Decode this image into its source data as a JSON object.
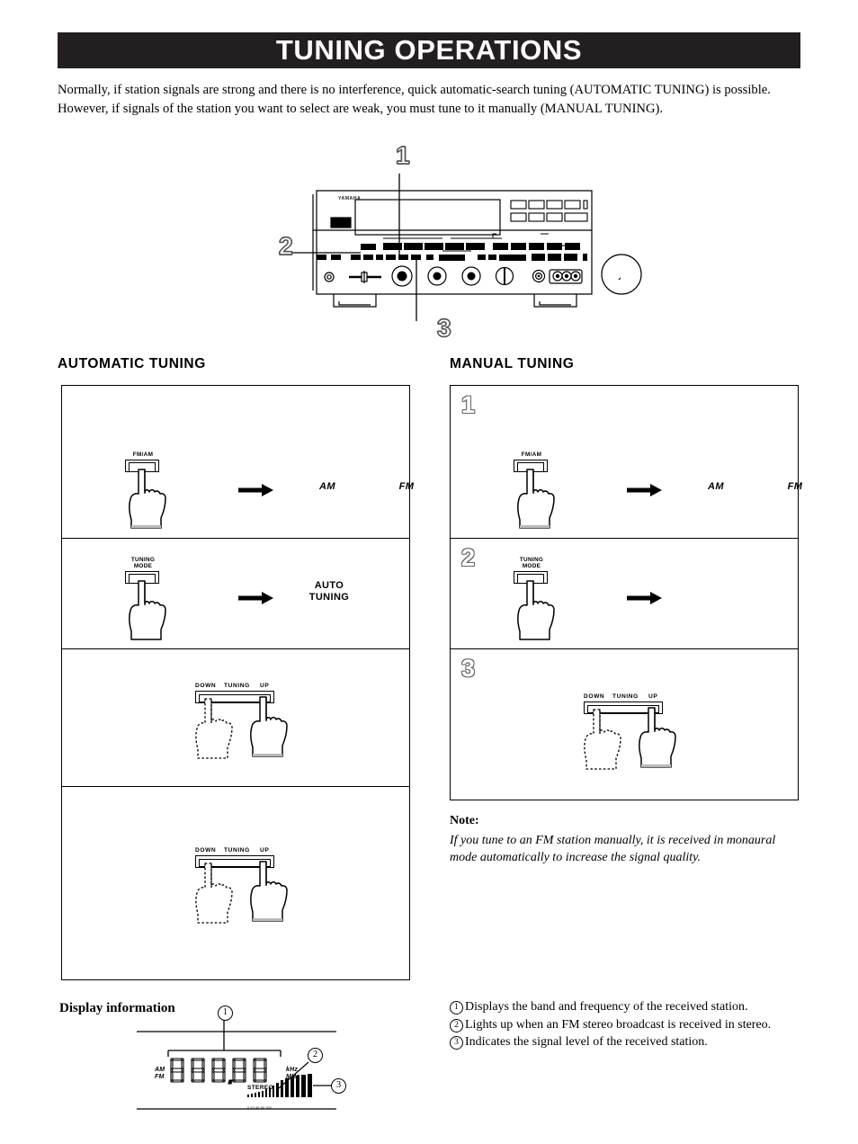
{
  "header": {
    "title": "TUNING OPERATIONS"
  },
  "intro": {
    "text": "Normally, if station signals are strong and there is no interference, quick automatic-search tuning (AUTOMATIC TUNING) is possible. However, if signals of the station you want to select are weak, you must tune to it manually (MANUAL TUNING)."
  },
  "receiver": {
    "brand": "YAMAHA",
    "callouts": [
      {
        "num": "1"
      },
      {
        "num": "2"
      },
      {
        "num": "3"
      }
    ]
  },
  "automatic": {
    "heading": "AUTOMATIC TUNING",
    "steps": [
      {
        "button_label": "FM/AM",
        "result_left": "AM",
        "result_right": "FM"
      },
      {
        "button_label_line1": "TUNING",
        "button_label_line2": "MODE",
        "result": "AUTO\nTUNING",
        "result_line1": "AUTO",
        "result_line2": "TUNING"
      },
      {
        "bar_left": "DOWN",
        "bar_mid": "TUNING",
        "bar_right": "UP"
      },
      {
        "bar_left": "DOWN",
        "bar_mid": "TUNING",
        "bar_right": "UP"
      }
    ]
  },
  "manual": {
    "heading": "MANUAL TUNING",
    "steps": [
      {
        "num": "1",
        "button_label": "FM/AM",
        "result_left": "AM",
        "result_right": "FM"
      },
      {
        "num": "2",
        "button_label_line1": "TUNING",
        "button_label_line2": "MODE"
      },
      {
        "num": "3",
        "bar_left": "DOWN",
        "bar_mid": "TUNING",
        "bar_right": "UP"
      }
    ],
    "note_head": "Note:",
    "note_body": "If you tune to an FM station manually, it is received in monaural mode automatically to increase the signal quality."
  },
  "display_info": {
    "heading": "Display information",
    "markers": {
      "one": "1",
      "two": "2",
      "three": "3"
    },
    "lcd": {
      "band_line1": "AM",
      "band_line2": "FM",
      "unit_line1": "kHz",
      "unit_line2": "MHz",
      "stereo": "STEREO",
      "meter_scale": "0   20   40   60        100"
    },
    "legend": [
      {
        "marker": "1",
        "text": "Displays the band and frequency of the received station."
      },
      {
        "marker": "2",
        "text": "Lights up when an FM stereo broadcast is received in stereo."
      },
      {
        "marker": "3",
        "text": "Indicates the signal level of the received station."
      }
    ]
  },
  "colors": {
    "header_bar": "#231f20",
    "header_text": "#ffffff",
    "ink": "#000000",
    "outline_num": "#666666",
    "page_bg": "#ffffff"
  }
}
